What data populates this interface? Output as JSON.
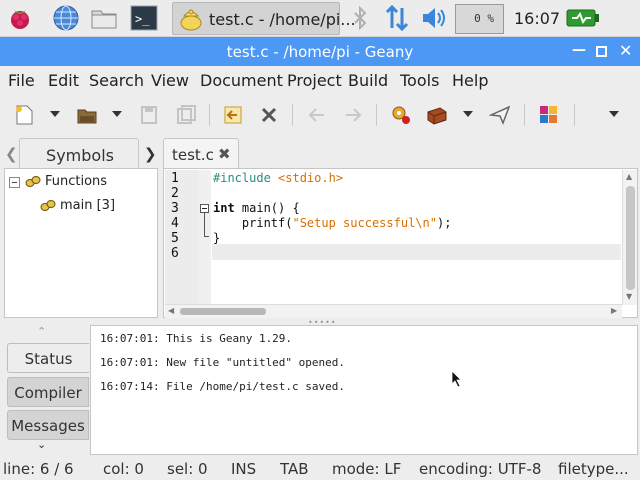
{
  "taskbar": {
    "task_label": "test.c - /home/pi...",
    "cpu": "0 %",
    "clock": "16:07"
  },
  "window": {
    "title": "test.c - /home/pi - Geany"
  },
  "menu": [
    "File",
    "Edit",
    "Search",
    "View",
    "Document",
    "Project",
    "Build",
    "Tools",
    "Help"
  ],
  "sidebar": {
    "tab_label": "Symbols",
    "functions_label": "Functions",
    "main_label": "main [3]"
  },
  "editor": {
    "tab_label": "test.c",
    "line_numbers": [
      "1",
      "2",
      "3",
      "4",
      "5",
      "6"
    ],
    "code": {
      "line1_pp": "#include",
      "line1_str": "<stdio.h>",
      "line3_kw": "int",
      "line3_rest": " main() {",
      "line4_a": "    printf(",
      "line4_str": "\"Setup successful\\n\"",
      "line4_b": ");",
      "line5": "}"
    }
  },
  "messages": {
    "tabs": [
      "Status",
      "Compiler",
      "Messages"
    ],
    "lines": [
      "16:07:01: This is Geany 1.29.",
      "16:07:01: New file \"untitled\" opened.",
      "16:07:14: File /home/pi/test.c saved."
    ]
  },
  "statusbar": {
    "line": "line: 6 / 6",
    "col": "col: 0",
    "sel": "sel: 0",
    "ins": "INS",
    "tab": "TAB",
    "mode": "mode: LF",
    "encoding": "encoding: UTF-8",
    "filetype": "filetype..."
  },
  "colors": {
    "titlebar": "#4d98f5",
    "keyword_preprocessor": "#2a8d7d",
    "string": "#d86f00"
  }
}
